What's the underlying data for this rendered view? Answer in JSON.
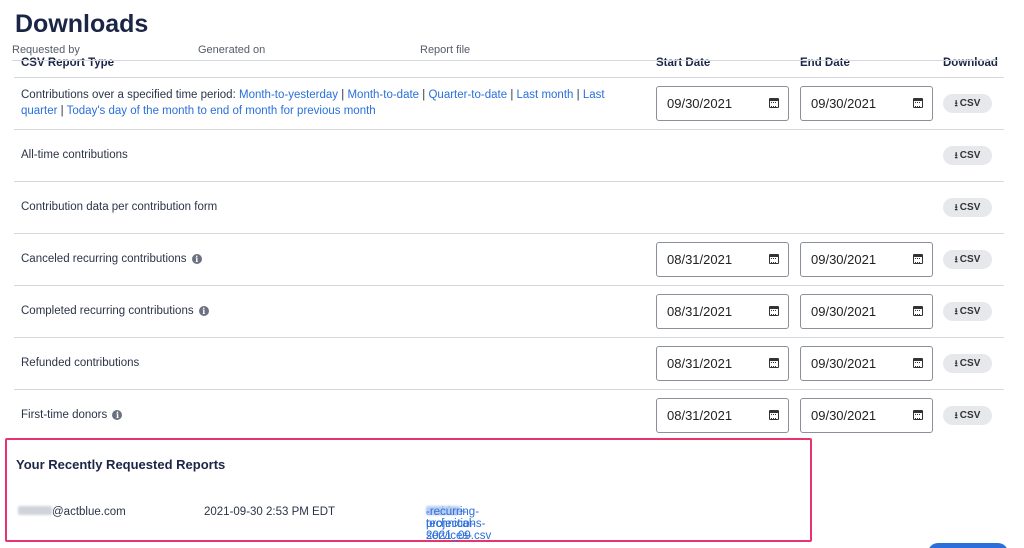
{
  "page": {
    "title": "Downloads"
  },
  "table": {
    "headers": {
      "type": "CSV Report Type",
      "start": "Start Date",
      "end": "End Date",
      "download": "Download"
    },
    "rows": [
      {
        "prefix": "Contributions over a specified time period:",
        "links": [
          "Month-to-yesterday",
          "Month-to-date",
          "Quarter-to-date",
          "Last month",
          "Last quarter",
          "Today's day of the month to end of month for previous month"
        ],
        "separator": "|",
        "start_date": "09/30/2021",
        "end_date": "09/30/2021",
        "csv_label": "CSV"
      },
      {
        "label": "All-time contributions",
        "csv_label": "CSV"
      },
      {
        "label": "Contribution data per contribution form",
        "csv_label": "CSV"
      },
      {
        "label": "Canceled recurring contributions",
        "info": "i",
        "start_date": "08/31/2021",
        "end_date": "09/30/2021",
        "csv_label": "CSV"
      },
      {
        "label": "Completed recurring contributions",
        "info": "i",
        "start_date": "08/31/2021",
        "end_date": "09/30/2021",
        "csv_label": "CSV"
      },
      {
        "label": "Refunded contributions",
        "start_date": "08/31/2021",
        "end_date": "09/30/2021",
        "csv_label": "CSV"
      },
      {
        "label": "First-time donors",
        "info": "i",
        "start_date": "08/31/2021",
        "end_date": "09/30/2021",
        "csv_label": "CSV"
      }
    ]
  },
  "recent": {
    "title": "Your Recently Requested Reports",
    "headers": {
      "requested_by": "Requested by",
      "generated_on": "Generated on",
      "report_file": "Report file"
    },
    "rows": [
      {
        "requested_by_suffix": "@actblue.com",
        "generated_on": "2021-09-30 2:53 PM EDT",
        "file_prefix": "actblue-technical-services-",
        "file_suffix": "-recurring-projections-2021_09.csv"
      }
    ]
  },
  "icons": {
    "calendar": "calendar-icon",
    "download": "download-icon",
    "info": "info-icon"
  },
  "colors": {
    "link": "#2a6fdb",
    "highlight_border": "#e8336d",
    "title": "#1b2546"
  }
}
